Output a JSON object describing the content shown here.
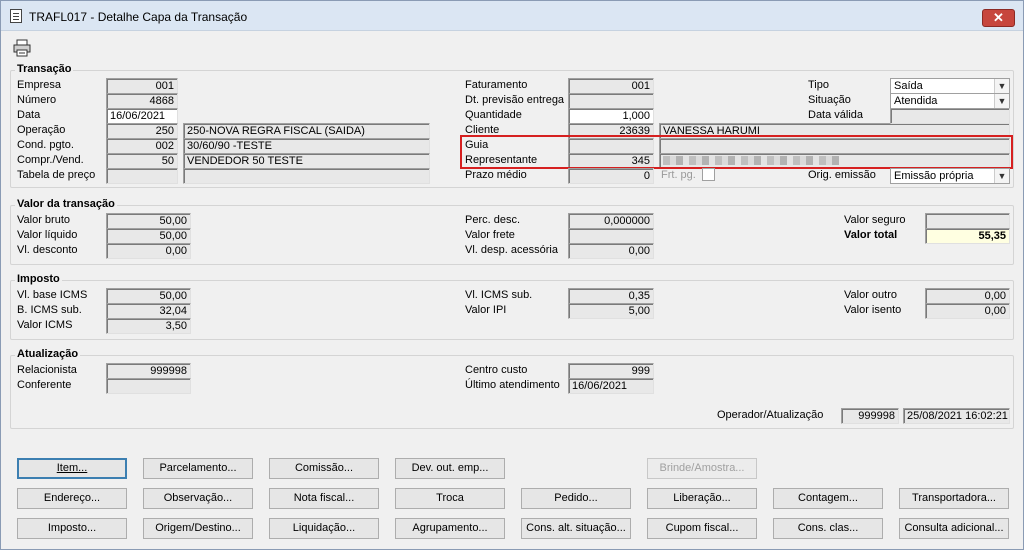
{
  "window": {
    "title": "TRAFL017 - Detalhe Capa da Transação",
    "close_glyph": "✕"
  },
  "transacao": {
    "title": "Transação",
    "empresa": {
      "label": "Empresa",
      "value": "001"
    },
    "numero": {
      "label": "Número",
      "value": "4868"
    },
    "data": {
      "label": "Data",
      "value": "16/06/2021"
    },
    "operacao": {
      "label": "Operação",
      "code": "250",
      "desc": "250-NOVA REGRA FISCAL (SAIDA)"
    },
    "cond_pgto": {
      "label": "Cond. pgto.",
      "code": "002",
      "desc": "30/60/90 -TESTE"
    },
    "compr_vend": {
      "label": "Compr./Vend.",
      "code": "50",
      "desc": "VENDEDOR 50 TESTE"
    },
    "tabela_preco": {
      "label": "Tabela de preço",
      "code": "",
      "desc": ""
    },
    "faturamento": {
      "label": "Faturamento",
      "value": "001"
    },
    "dt_previsao": {
      "label": "Dt. previsão entrega",
      "value": ""
    },
    "quantidade": {
      "label": "Quantidade",
      "value": "1,000"
    },
    "cliente": {
      "label": "Cliente",
      "code": "23639",
      "name": "VANESSA HARUMI"
    },
    "guia": {
      "label": "Guia",
      "code": "",
      "name": ""
    },
    "representante": {
      "label": "Representante",
      "code": "345",
      "name": ""
    },
    "prazo_medio": {
      "label": "Prazo médio",
      "value": "0"
    },
    "frt_pg": {
      "label": "Frt. pg."
    },
    "tipo": {
      "label": "Tipo",
      "value": "Saída"
    },
    "situacao": {
      "label": "Situação",
      "value": "Atendida"
    },
    "data_valida": {
      "label": "Data válida",
      "value": ""
    },
    "orig_emissao": {
      "label": "Orig. emissão",
      "value": "Emissão própria"
    }
  },
  "valor": {
    "title": "Valor da transação",
    "valor_bruto": {
      "label": "Valor bruto",
      "value": "50,00"
    },
    "valor_liquido": {
      "label": "Valor líquido",
      "value": "50,00"
    },
    "vl_desconto": {
      "label": "Vl. desconto",
      "value": "0,00"
    },
    "perc_desc": {
      "label": "Perc. desc.",
      "value": "0,000000"
    },
    "valor_frete": {
      "label": "Valor frete",
      "value": ""
    },
    "vl_desp_acessoria": {
      "label": "Vl. desp. acessória",
      "value": "0,00"
    },
    "valor_seguro": {
      "label": "Valor seguro",
      "value": ""
    },
    "valor_total": {
      "label": "Valor total",
      "value": "55,35"
    }
  },
  "imposto": {
    "title": "Imposto",
    "vl_base_icms": {
      "label": "Vl. base ICMS",
      "value": "50,00"
    },
    "b_icms_sub": {
      "label": "B. ICMS sub.",
      "value": "32,04"
    },
    "valor_icms": {
      "label": "Valor ICMS",
      "value": "3,50"
    },
    "vl_icms_sub": {
      "label": "Vl. ICMS sub.",
      "value": "0,35"
    },
    "valor_ipi": {
      "label": "Valor IPI",
      "value": "5,00"
    },
    "valor_outro": {
      "label": "Valor outro",
      "value": "0,00"
    },
    "valor_isento": {
      "label": "Valor isento",
      "value": "0,00"
    }
  },
  "atualizacao": {
    "title": "Atualização",
    "relacionista": {
      "label": "Relacionista",
      "value": "999998"
    },
    "conferente": {
      "label": "Conferente",
      "value": ""
    },
    "centro_custo": {
      "label": "Centro custo",
      "value": "999"
    },
    "ultimo_atendimento": {
      "label": "Último atendimento",
      "value": "16/06/2021"
    },
    "operador": {
      "label": "Operador/Atualização",
      "code": "999998",
      "datetime": "25/08/2021 16:02:21"
    }
  },
  "buttons": {
    "item": "Item...",
    "parcelamento": "Parcelamento...",
    "comissao": "Comissão...",
    "dev_out_emp": "Dev. out. emp...",
    "brinde_amostra": "Brinde/Amostra...",
    "endereco": "Endereço...",
    "observacao": "Observação...",
    "nota_fiscal": "Nota fiscal...",
    "troca": "Troca",
    "pedido": "Pedido...",
    "liberacao": "Liberação...",
    "contagem": "Contagem...",
    "transportadora": "Transportadora...",
    "imposto": "Imposto...",
    "origem_destino": "Origem/Destino...",
    "liquidacao": "Liquidação...",
    "agrupamento": "Agrupamento...",
    "cons_alt_situacao": "Cons. alt. situação...",
    "cupom_fiscal": "Cupom fiscal...",
    "cons_clas": "Cons. clas...",
    "consulta_adicional": "Consulta adicional..."
  },
  "colors": {
    "highlight_box": "#d62020",
    "total_field": "#ffffe1",
    "title_bar": "#dbe6f3"
  }
}
